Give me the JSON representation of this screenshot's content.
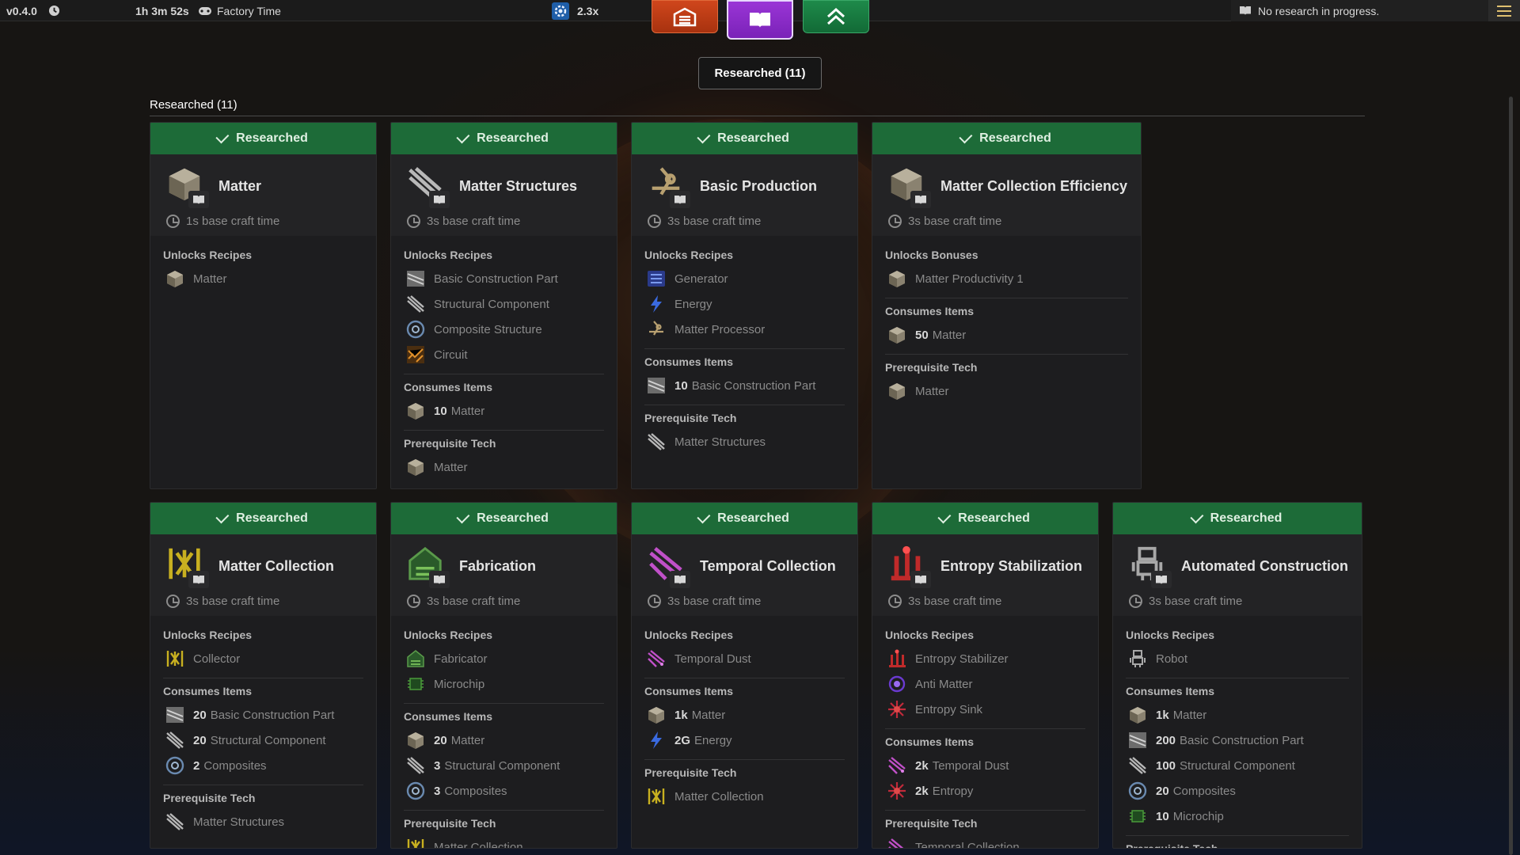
{
  "topbar": {
    "version": "v0.4.0",
    "play_time": "1h 3m 52s",
    "factory_time_label": "Factory Time",
    "speed": "2.3x",
    "research_status": "No research in progress."
  },
  "filter_label": "Researched (11)",
  "section_title": "Researched (11)",
  "colors": {
    "researched_bar": "#1d6b38",
    "accent_gold": "#e0c070"
  },
  "cards": [
    {
      "status": "Researched",
      "title": "Matter",
      "icon": "matter-icon",
      "craft_time": "1s base craft time",
      "sections": [
        {
          "title": "Unlocks Recipes",
          "items": [
            {
              "name": "Matter",
              "icon": "matter-icon"
            }
          ]
        }
      ]
    },
    {
      "status": "Researched",
      "title": "Matter Structures",
      "icon": "structure-icon",
      "craft_time": "3s base craft time",
      "sections": [
        {
          "title": "Unlocks Recipes",
          "items": [
            {
              "name": "Basic Construction Part",
              "icon": "construction-part-icon"
            },
            {
              "name": "Structural Component",
              "icon": "structure-icon"
            },
            {
              "name": "Composite Structure",
              "icon": "composite-icon"
            },
            {
              "name": "Circuit",
              "icon": "circuit-icon"
            }
          ]
        },
        {
          "title": "Consumes Items",
          "items": [
            {
              "qty": "10",
              "name": "Matter",
              "icon": "matter-icon"
            }
          ]
        },
        {
          "title": "Prerequisite Tech",
          "items": [
            {
              "name": "Matter",
              "icon": "matter-icon"
            }
          ]
        }
      ]
    },
    {
      "status": "Researched",
      "title": "Basic Production",
      "icon": "processor-icon",
      "craft_time": "3s base craft time",
      "sections": [
        {
          "title": "Unlocks Recipes",
          "items": [
            {
              "name": "Generator",
              "icon": "generator-icon"
            },
            {
              "name": "Energy",
              "icon": "energy-icon"
            },
            {
              "name": "Matter Processor",
              "icon": "processor-icon"
            }
          ]
        },
        {
          "title": "Consumes Items",
          "items": [
            {
              "qty": "10",
              "name": "Basic Construction Part",
              "icon": "construction-part-icon"
            }
          ]
        },
        {
          "title": "Prerequisite Tech",
          "items": [
            {
              "name": "Matter Structures",
              "icon": "structure-icon"
            }
          ]
        }
      ]
    },
    {
      "status": "Researched",
      "title": "Matter Collection Efficiency",
      "icon": "matter-icon",
      "craft_time": "3s base craft time",
      "sections": [
        {
          "title": "Unlocks Bonuses",
          "items": [
            {
              "name": "Matter Productivity 1",
              "icon": "matter-icon"
            }
          ]
        },
        {
          "title": "Consumes Items",
          "items": [
            {
              "qty": "50",
              "name": "Matter",
              "icon": "matter-icon"
            }
          ]
        },
        {
          "title": "Prerequisite Tech",
          "items": [
            {
              "name": "Matter",
              "icon": "matter-icon"
            }
          ]
        }
      ]
    },
    {
      "status": "Researched",
      "title": "Matter Collection",
      "icon": "collector-icon",
      "craft_time": "3s base craft time",
      "sections": [
        {
          "title": "Unlocks Recipes",
          "items": [
            {
              "name": "Collector",
              "icon": "collector-icon"
            }
          ]
        },
        {
          "title": "Consumes Items",
          "items": [
            {
              "qty": "20",
              "name": "Basic Construction Part",
              "icon": "construction-part-icon"
            },
            {
              "qty": "20",
              "name": "Structural Component",
              "icon": "structure-icon"
            },
            {
              "qty": "2",
              "name": "Composites",
              "icon": "composite-icon"
            }
          ]
        },
        {
          "title": "Prerequisite Tech",
          "items": [
            {
              "name": "Matter Structures",
              "icon": "structure-icon"
            }
          ]
        }
      ]
    },
    {
      "status": "Researched",
      "title": "Fabrication",
      "icon": "fabricator-icon",
      "craft_time": "3s base craft time",
      "sections": [
        {
          "title": "Unlocks Recipes",
          "items": [
            {
              "name": "Fabricator",
              "icon": "fabricator-icon"
            },
            {
              "name": "Microchip",
              "icon": "microchip-icon"
            }
          ]
        },
        {
          "title": "Consumes Items",
          "items": [
            {
              "qty": "20",
              "name": "Matter",
              "icon": "matter-icon"
            },
            {
              "qty": "3",
              "name": "Structural Component",
              "icon": "structure-icon"
            },
            {
              "qty": "3",
              "name": "Composites",
              "icon": "composite-icon"
            }
          ]
        },
        {
          "title": "Prerequisite Tech",
          "items": [
            {
              "name": "Matter Collection",
              "icon": "collector-icon"
            }
          ]
        }
      ]
    },
    {
      "status": "Researched",
      "title": "Temporal Collection",
      "icon": "temporal-dust-icon",
      "craft_time": "3s base craft time",
      "sections": [
        {
          "title": "Unlocks Recipes",
          "items": [
            {
              "name": "Temporal Dust",
              "icon": "temporal-dust-icon"
            }
          ]
        },
        {
          "title": "Consumes Items",
          "items": [
            {
              "qty": "1k",
              "name": "Matter",
              "icon": "matter-icon"
            },
            {
              "qty": "2G",
              "name": "Energy",
              "icon": "energy-icon"
            }
          ]
        },
        {
          "title": "Prerequisite Tech",
          "items": [
            {
              "name": "Matter Collection",
              "icon": "collector-icon"
            }
          ]
        }
      ]
    },
    {
      "status": "Researched",
      "title": "Entropy Stabilization",
      "icon": "entropy-stabilizer-icon",
      "craft_time": "3s base craft time",
      "sections": [
        {
          "title": "Unlocks Recipes",
          "items": [
            {
              "name": "Entropy Stabilizer",
              "icon": "entropy-stabilizer-icon"
            },
            {
              "name": "Anti Matter",
              "icon": "anti-matter-icon"
            },
            {
              "name": "Entropy Sink",
              "icon": "entropy-icon"
            }
          ]
        },
        {
          "title": "Consumes Items",
          "items": [
            {
              "qty": "2k",
              "name": "Temporal Dust",
              "icon": "temporal-dust-icon"
            },
            {
              "qty": "2k",
              "name": "Entropy",
              "icon": "entropy-icon"
            }
          ]
        },
        {
          "title": "Prerequisite Tech",
          "items": [
            {
              "name": "Temporal Collection",
              "icon": "temporal-dust-icon"
            }
          ]
        }
      ]
    },
    {
      "status": "Researched",
      "title": "Automated Construction",
      "icon": "robot-icon",
      "craft_time": "3s base craft time",
      "sections": [
        {
          "title": "Unlocks Recipes",
          "items": [
            {
              "name": "Robot",
              "icon": "robot-icon"
            }
          ]
        },
        {
          "title": "Consumes Items",
          "items": [
            {
              "qty": "1k",
              "name": "Matter",
              "icon": "matter-icon"
            },
            {
              "qty": "200",
              "name": "Basic Construction Part",
              "icon": "construction-part-icon"
            },
            {
              "qty": "100",
              "name": "Structural Component",
              "icon": "structure-icon"
            },
            {
              "qty": "20",
              "name": "Composites",
              "icon": "composite-icon"
            },
            {
              "qty": "10",
              "name": "Microchip",
              "icon": "microchip-icon"
            }
          ]
        },
        {
          "title": "Prerequisite Tech",
          "items": []
        }
      ]
    }
  ]
}
